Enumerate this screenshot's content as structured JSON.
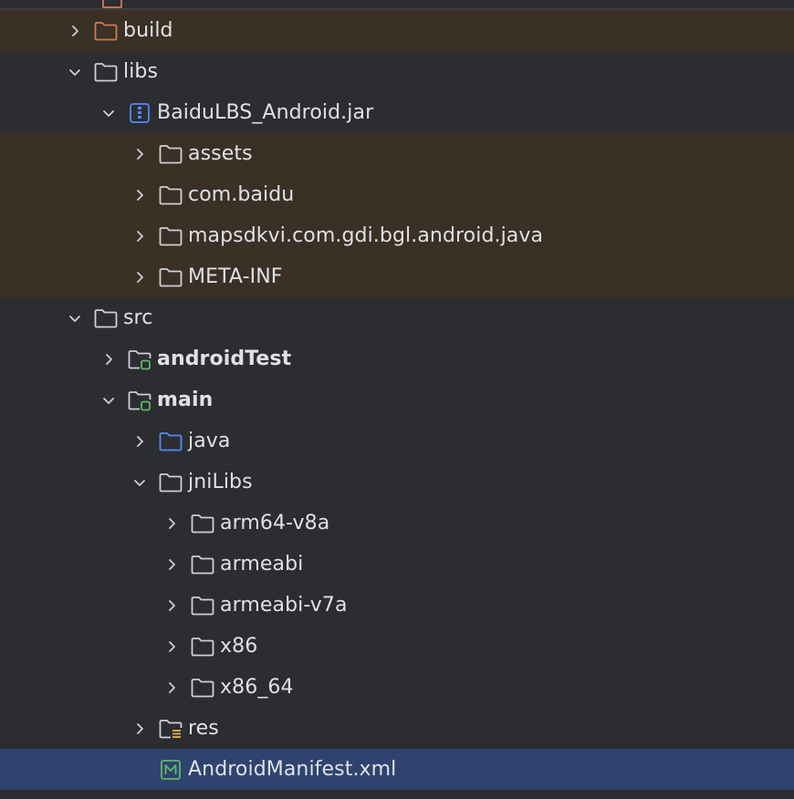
{
  "project_tree": {
    "items": [
      {
        "label": "build",
        "icon": "folder-excluded-icon",
        "expanded": false,
        "style": "excluded"
      },
      {
        "label": "libs",
        "icon": "folder-icon",
        "expanded": true,
        "style": "normal"
      },
      {
        "label": "BaiduLBS_Android.jar",
        "icon": "jar-archive-icon",
        "expanded": true,
        "style": "normal"
      },
      {
        "label": "assets",
        "icon": "folder-icon",
        "expanded": false,
        "style": "excluded"
      },
      {
        "label": "com.baidu",
        "icon": "folder-icon",
        "expanded": false,
        "style": "excluded"
      },
      {
        "label": "mapsdkvi.com.gdi.bgl.android.java",
        "icon": "folder-icon",
        "expanded": false,
        "style": "excluded"
      },
      {
        "label": "META-INF",
        "icon": "folder-icon",
        "expanded": false,
        "style": "excluded"
      },
      {
        "label": "src",
        "icon": "folder-icon",
        "expanded": true,
        "style": "normal"
      },
      {
        "label": "androidTest",
        "icon": "source-set-folder-icon",
        "expanded": false,
        "style": "bold"
      },
      {
        "label": "main",
        "icon": "source-set-folder-icon",
        "expanded": true,
        "style": "bold"
      },
      {
        "label": "java",
        "icon": "source-root-folder-icon",
        "expanded": false,
        "style": "normal"
      },
      {
        "label": "jniLibs",
        "icon": "folder-icon",
        "expanded": true,
        "style": "normal"
      },
      {
        "label": "arm64-v8a",
        "icon": "folder-icon",
        "expanded": false,
        "style": "normal"
      },
      {
        "label": "armeabi",
        "icon": "folder-icon",
        "expanded": false,
        "style": "normal"
      },
      {
        "label": "armeabi-v7a",
        "icon": "folder-icon",
        "expanded": false,
        "style": "normal"
      },
      {
        "label": "x86",
        "icon": "folder-icon",
        "expanded": false,
        "style": "normal"
      },
      {
        "label": "x86_64",
        "icon": "folder-icon",
        "expanded": false,
        "style": "normal"
      },
      {
        "label": "res",
        "icon": "resource-folder-icon",
        "expanded": false,
        "style": "normal"
      },
      {
        "label": "AndroidManifest.xml",
        "icon": "manifest-file-icon",
        "expanded": null,
        "style": "selected"
      }
    ]
  },
  "colors": {
    "background": "#2b2d30",
    "excluded_row": "#3b3026",
    "selected_row": "#2e436e",
    "text": "#dfe1e5",
    "folder_stroke": "#ced0d6",
    "excluded_folder_stroke": "#c77d55",
    "source_root_stroke": "#548af7",
    "source_set_badge": "#5fb865",
    "manifest_green": "#5fb865"
  }
}
